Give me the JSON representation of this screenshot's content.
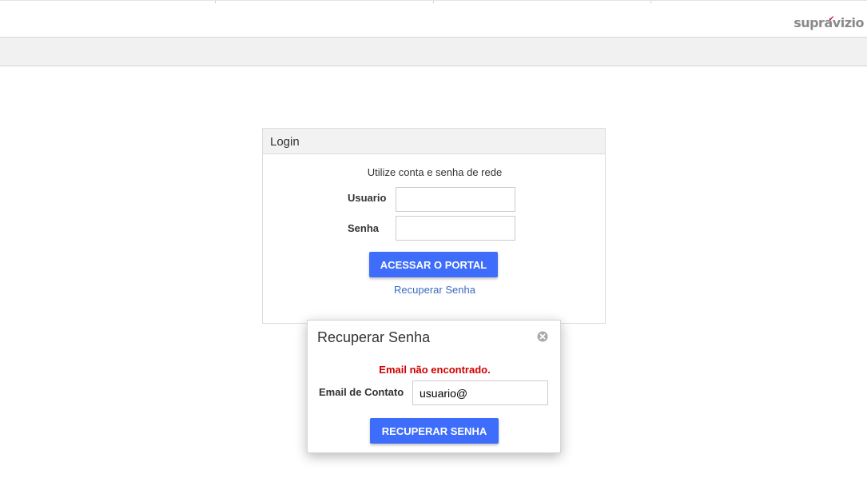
{
  "header": {
    "logo_text": "supravizio",
    "logo_text_part1": "supra",
    "logo_mark": "✔",
    "logo_text_part2": "vizio"
  },
  "login": {
    "title": "Login",
    "hint": "Utilize conta e senha de rede",
    "username_label": "Usuario",
    "username_value": "",
    "password_label": "Senha",
    "password_value": "",
    "submit_label": "ACESSAR O PORTAL",
    "recover_link": "Recuperar Senha"
  },
  "recover_modal": {
    "title": "Recuperar Senha",
    "close_icon": "close-circle-icon",
    "error": "Email não encontrado.",
    "email_label": "Email de Contato",
    "email_value": "usuario@",
    "submit_label": "RECUPERAR SENHA"
  },
  "colors": {
    "accent": "#3d6dfa",
    "error": "#d00000",
    "link": "#3a6bc3"
  }
}
